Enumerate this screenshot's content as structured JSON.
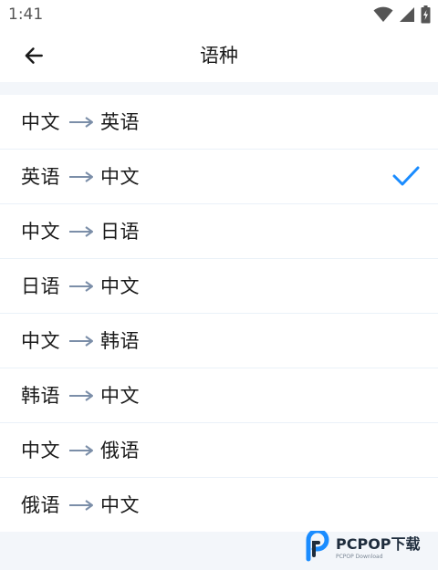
{
  "status_bar": {
    "time": "1:41",
    "icons": [
      "wifi-icon",
      "cellular-signal-icon",
      "battery-icon"
    ]
  },
  "header": {
    "title": "语种",
    "back_icon": "arrow-back-icon"
  },
  "languages": {
    "items": [
      {
        "from": "中文",
        "to": "英语",
        "selected": false
      },
      {
        "from": "英语",
        "to": "中文",
        "selected": true
      },
      {
        "from": "中文",
        "to": "日语",
        "selected": false
      },
      {
        "from": "日语",
        "to": "中文",
        "selected": false
      },
      {
        "from": "中文",
        "to": "韩语",
        "selected": false
      },
      {
        "from": "韩语",
        "to": "中文",
        "selected": false
      },
      {
        "from": "中文",
        "to": "俄语",
        "selected": false
      },
      {
        "from": "俄语",
        "to": "中文",
        "selected": false
      }
    ],
    "arrow_icon": "arrow-right-icon",
    "check_icon": "checkmark-icon"
  },
  "watermark": {
    "text": "PCPOP下载",
    "subtext": "PCPOP Download"
  },
  "colors": {
    "accent": "#1a8cff",
    "arrow": "#7b8ea8",
    "text": "#1a1a1a",
    "band": "#f3f6fa",
    "divider": "#eaf1f8"
  }
}
